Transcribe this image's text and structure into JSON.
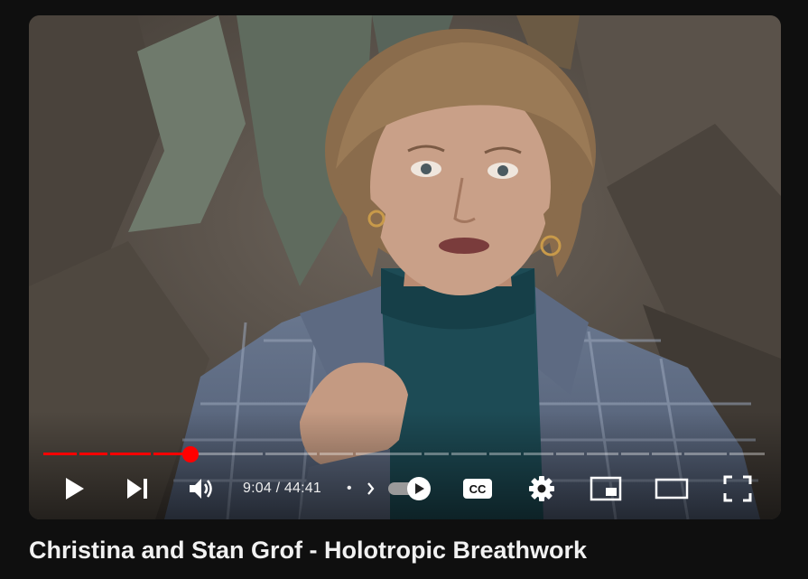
{
  "player": {
    "progress_fraction": 0.2036,
    "current_time": "9:04",
    "separator": " / ",
    "duration": "44:41",
    "chapter_dot": "•",
    "autoplay_on": true,
    "colors": {
      "played": "#ff0000",
      "unplayed": "rgba(255,255,255,0.35)",
      "icon": "#ffffff"
    },
    "icons": {
      "play": "play-icon",
      "next": "skip-next-icon",
      "volume": "volume-icon",
      "chapter": "chevron-right-icon",
      "autoplay": "autoplay-toggle-icon",
      "captions": "captions-icon",
      "settings": "gear-icon",
      "miniplayer": "miniplayer-icon",
      "theater": "theater-mode-icon",
      "fullscreen": "fullscreen-icon"
    }
  },
  "video": {
    "title": "Christina and Stan Grof - Holotropic Breathwork"
  }
}
